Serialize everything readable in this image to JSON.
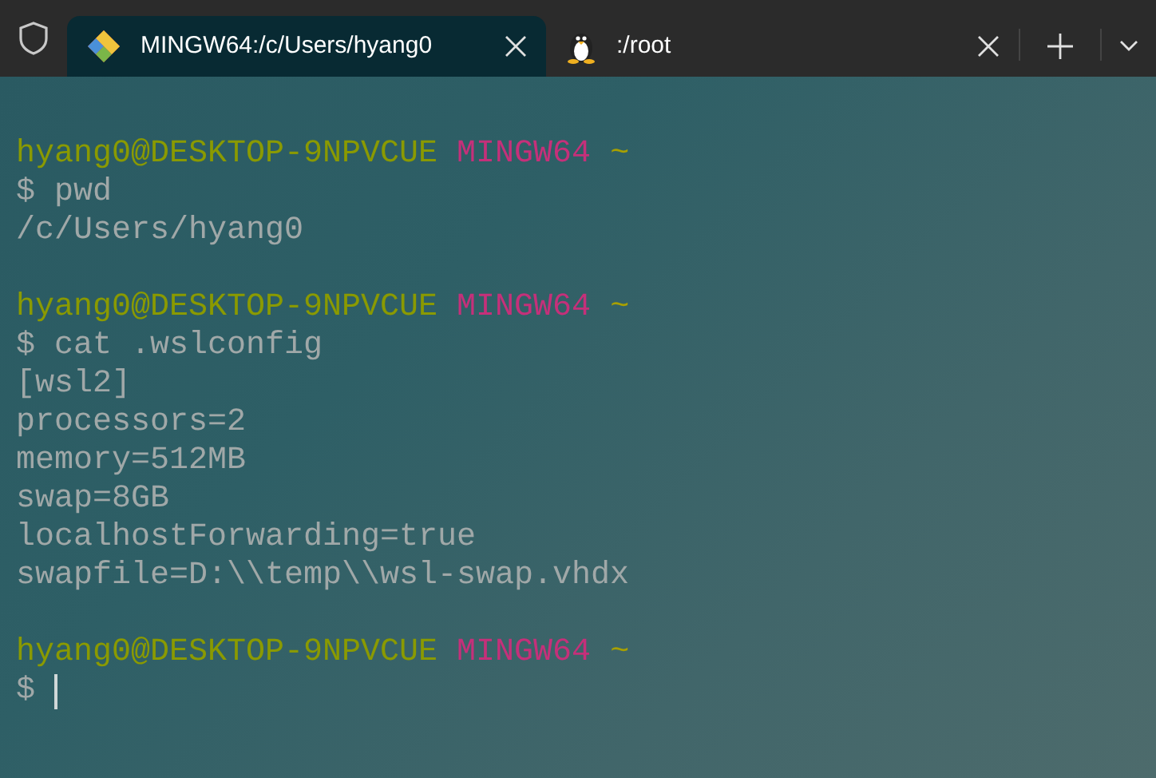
{
  "tabs": [
    {
      "title": "MINGW64:/c/Users/hyang0",
      "kind": "git",
      "selected": true
    },
    {
      "title": ":/root",
      "kind": "penguin",
      "selected": false
    }
  ],
  "lines": [
    {
      "kind": "prompt",
      "user": "hyang0@DESKTOP-9NPVCUE",
      "shell": "MINGW64",
      "path": "~"
    },
    {
      "kind": "command",
      "sign": "$",
      "text": "pwd"
    },
    {
      "kind": "output",
      "text": "/c/Users/hyang0"
    },
    {
      "kind": "blank"
    },
    {
      "kind": "prompt",
      "user": "hyang0@DESKTOP-9NPVCUE",
      "shell": "MINGW64",
      "path": "~"
    },
    {
      "kind": "command",
      "sign": "$",
      "text": "cat .wslconfig"
    },
    {
      "kind": "output",
      "text": "[wsl2]"
    },
    {
      "kind": "output",
      "text": "processors=2"
    },
    {
      "kind": "output",
      "text": "memory=512MB"
    },
    {
      "kind": "output",
      "text": "swap=8GB"
    },
    {
      "kind": "output",
      "text": "localhostForwarding=true"
    },
    {
      "kind": "output",
      "text": "swapfile=D:\\\\temp\\\\wsl-swap.vhdx"
    },
    {
      "kind": "blank"
    },
    {
      "kind": "prompt",
      "user": "hyang0@DESKTOP-9NPVCUE",
      "shell": "MINGW64",
      "path": "~"
    },
    {
      "kind": "command",
      "sign": "$",
      "cursor": true
    }
  ]
}
